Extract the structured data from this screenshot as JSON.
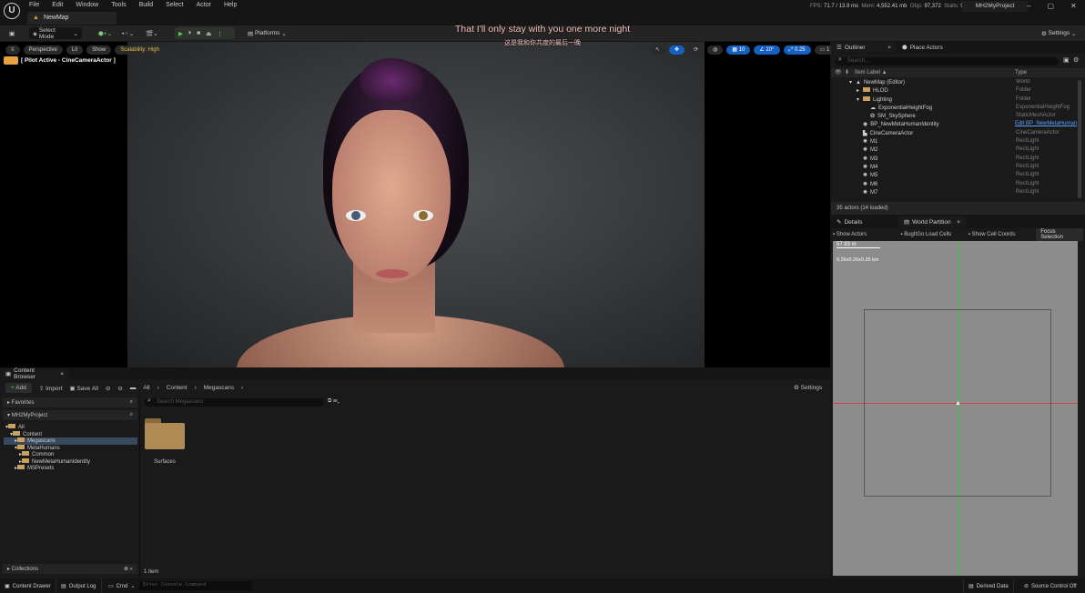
{
  "menu": [
    "File",
    "Edit",
    "Window",
    "Tools",
    "Build",
    "Select",
    "Actor",
    "Help"
  ],
  "map_tab": "NewMap",
  "stats": {
    "fps_label": "FPS:",
    "fps": "71.7",
    "ms": "/ 13.9 ms",
    "mem_label": "Mem:",
    "mem": "4,552.41 mb",
    "objs_label": "Objs:",
    "objs": "97,372",
    "stalls_label": "Stalls:",
    "stalls": "9"
  },
  "project": "MH2MyProject",
  "toolbar": {
    "select_mode": "Select Mode",
    "platforms": "Platforms",
    "settings": "Settings"
  },
  "subtitle": {
    "en": "That I'll only stay with you one more night",
    "zh": "这是我和你共度的最后一晚"
  },
  "viewport": {
    "perspective": "Perspective",
    "lit": "Lit",
    "show": "Show",
    "scalability": "Scalability: High",
    "pilot": "[ Pilot Active - CineCameraActor ]",
    "grid": "10",
    "angle": "10°",
    "scale": "0.25",
    "camera_speed": "1"
  },
  "outliner": {
    "tab": "Outliner",
    "place_actors": "Place Actors",
    "search_placeholder": "Search...",
    "col_label": "Item Label ▲",
    "col_type": "Type",
    "rows": [
      {
        "label": "NewMap (Editor)",
        "type": "World",
        "indent": 2,
        "icon": "map"
      },
      {
        "label": "HLOD",
        "type": "Folder",
        "indent": 3,
        "icon": "folder"
      },
      {
        "label": "Lighting",
        "type": "Folder",
        "indent": 3,
        "icon": "folder"
      },
      {
        "label": "ExponentialHeightFog",
        "type": "ExponentialHeightFog",
        "indent": 4,
        "icon": "fog"
      },
      {
        "label": "SM_SkySphere",
        "type": "StaticMeshActor",
        "indent": 4,
        "icon": "mesh"
      },
      {
        "label": "BP_NewMetaHumanIdentity",
        "type": "Edit BP_NewMetaHuman",
        "indent": 3,
        "icon": "bp",
        "link": true
      },
      {
        "label": "CineCameraActor",
        "type": "CineCameraActor",
        "indent": 3,
        "icon": "camera"
      },
      {
        "label": "M1",
        "type": "RectLight",
        "indent": 3,
        "icon": "light"
      },
      {
        "label": "M2",
        "type": "RectLight",
        "indent": 3,
        "icon": "light"
      },
      {
        "label": "M3",
        "type": "RectLight",
        "indent": 3,
        "icon": "light"
      },
      {
        "label": "M4",
        "type": "RectLight",
        "indent": 3,
        "icon": "light"
      },
      {
        "label": "M5",
        "type": "RectLight",
        "indent": 3,
        "icon": "light"
      },
      {
        "label": "M6",
        "type": "RectLight",
        "indent": 3,
        "icon": "light"
      },
      {
        "label": "M7",
        "type": "RectLight",
        "indent": 3,
        "icon": "light"
      }
    ],
    "count": "35 actors (14 loaded)"
  },
  "details": {
    "tab": "Details",
    "wp_tab": "World Partition",
    "show_actors": "Show Actors",
    "bugitgo": "BugItGo Load Cells",
    "cell_coords": "Show Cell Coords",
    "focus": "Focus Selection",
    "scale": "57.83 m",
    "size": "0.26x0.26x0.26 km"
  },
  "content_browser": {
    "tab": "Content Browser",
    "add": "Add",
    "import": "Import",
    "save_all": "Save All",
    "breadcrumb": [
      "All",
      "Content",
      "Megascans"
    ],
    "settings": "Settings",
    "favorites": "Favorites",
    "project": "MH2MyProject",
    "search_placeholder": "Search Megascans",
    "tree": [
      {
        "label": "All",
        "indent": 0
      },
      {
        "label": "Content",
        "indent": 1
      },
      {
        "label": "Megascans",
        "indent": 2,
        "selected": true
      },
      {
        "label": "MetaHumans",
        "indent": 2
      },
      {
        "label": "Common",
        "indent": 3
      },
      {
        "label": "NewMetaHumanIdentity",
        "indent": 3
      },
      {
        "label": "MSPresets",
        "indent": 2
      }
    ],
    "items": [
      {
        "label": "Surfaces"
      }
    ],
    "count": "1 item",
    "collections": "Collections"
  },
  "statusbar": {
    "content_drawer": "Content Drawer",
    "output_log": "Output Log",
    "cmd": "Cmd",
    "console_placeholder": "Enter Console Command",
    "derived_data": "Derived Data",
    "source_control": "Source Control Off"
  }
}
